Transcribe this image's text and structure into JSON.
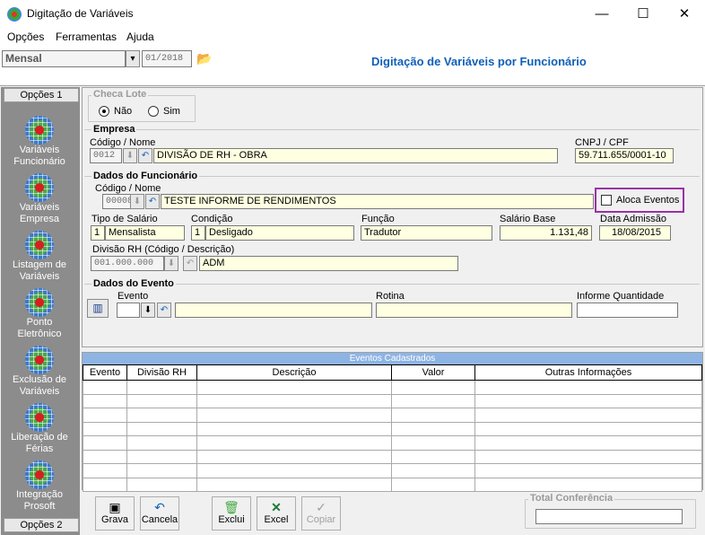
{
  "window": {
    "title": "Digitação de Variáveis",
    "minimize": "—",
    "maximize": "☐",
    "close": "✕"
  },
  "menu": [
    {
      "label": "Opções"
    },
    {
      "label": "Ferramentas"
    },
    {
      "label": "Ajuda"
    }
  ],
  "toolbar": {
    "period_select": "Mensal",
    "period_date": "01/2018",
    "folder_icon": "📂",
    "heading": "Digitação de Variáveis por Funcionário"
  },
  "sidebar": {
    "tab_top": "Opções 1",
    "tab_bottom": "Opções 2",
    "items": [
      {
        "label": "Variáveis Funcionário",
        "icon": "variaveis-funcionario-icon"
      },
      {
        "label": "Variáveis Empresa",
        "icon": "variaveis-empresa-icon"
      },
      {
        "label": "Listagem de Variáveis",
        "icon": "listagem-icon"
      },
      {
        "label": "Ponto Eletrônico",
        "icon": "ponto-icon"
      },
      {
        "label": "Exclusão de Variáveis",
        "icon": "exclusao-icon"
      },
      {
        "label": "Liberação de Férias",
        "icon": "ferias-icon"
      },
      {
        "label": "Integração Prosoft",
        "icon": "integracao-icon"
      }
    ]
  },
  "checa_lote": {
    "title": "Checa Lote",
    "nao": "Não",
    "sim": "Sim",
    "selected": "Não"
  },
  "empresa": {
    "title": "Empresa",
    "codigo_label": "Código / Nome",
    "codigo": "0012",
    "nome": "DIVISÃO DE RH - OBRA",
    "cnpj_label": "CNPJ / CPF",
    "cnpj": "59.711.655/0001-10"
  },
  "funcionario": {
    "title": "Dados do Funcionário",
    "codigo_label": "Código / Nome",
    "codigo": "00008",
    "nome": "TESTE INFORME DE RENDIMENTOS",
    "aloca": "Aloca Eventos",
    "tipo_label": "Tipo de Salário",
    "tipo_code": "1",
    "tipo": "Mensalista",
    "cond_label": "Condição",
    "cond_code": "1",
    "cond": "Desligado",
    "funcao_label": "Função",
    "funcao": "Tradutor",
    "salario_label": "Salário Base",
    "salario": "1.131,48",
    "admissao_label": "Data Admissão",
    "admissao": "18/08/2015",
    "divisao_label": "Divisão RH (Código / Descrição)",
    "divisao_code": "001.000.000",
    "divisao": "ADM"
  },
  "evento": {
    "title": "Dados do Evento",
    "evento_label": "Evento",
    "rotina_label": "Rotina",
    "quantidade_label": "Informe Quantidade"
  },
  "eventos": {
    "title": "Eventos Cadastrados",
    "columns": [
      "Evento",
      "Divisão RH",
      "Descrição",
      "Valor",
      "Outras Informações"
    ]
  },
  "actions": {
    "grava": "Grava",
    "cancela": "Cancela",
    "exclui": "Exclui",
    "excel": "Excel",
    "copiar": "Copiar"
  },
  "total": {
    "title": "Total Conferência",
    "value": ""
  },
  "colors": {
    "field_bg": "#ffffe1",
    "heading": "#1060b8",
    "highlight": "#9b30a8",
    "grid_header": "#8eb4e3"
  }
}
